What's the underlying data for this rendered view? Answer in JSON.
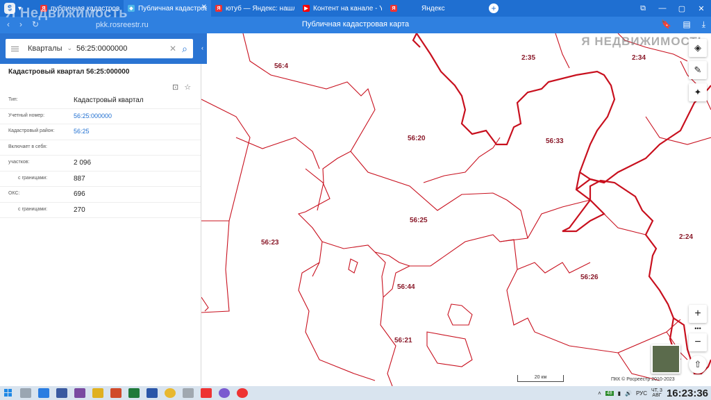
{
  "browser": {
    "tabs": [
      {
        "label": "публичная кадастровая к",
        "favicon": "yandex-icon",
        "active": false
      },
      {
        "label": "Публичная кадастрова",
        "favicon": "pkk-icon",
        "active": true
      },
      {
        "label": "ютуб — Яндекс: нашлось",
        "favicon": "yandex-icon",
        "active": false
      },
      {
        "label": "Контент на канале - YouTu",
        "favicon": "youtube-icon",
        "active": false
      },
      {
        "label": "Яндекс",
        "favicon": "yandex-icon",
        "active": false
      }
    ],
    "url": "pkk.rosreestr.ru",
    "page_title": "Публичная кадастровая карта"
  },
  "watermark": {
    "left": "Я Недвижимость",
    "right": "Я НЕДВИЖИМОСТЬ"
  },
  "search": {
    "type_selected": "Кварталы",
    "query": "56:25:0000000"
  },
  "info": {
    "title": "Кадастровый квартал 56:25:000000",
    "rows": [
      {
        "key": "Тип:",
        "value": "Кадастровый квартал",
        "link": false,
        "sub": false
      },
      {
        "key": "Учетный номер:",
        "value": "56:25:000000",
        "link": true,
        "sub": false
      },
      {
        "key": "Кадастровый район:",
        "value": "56:25",
        "link": true,
        "sub": false
      },
      {
        "key": "Включает в себя:",
        "value": "",
        "link": false,
        "sub": false
      },
      {
        "key": "участков:",
        "value": "2 096",
        "link": false,
        "sub": false
      },
      {
        "key": "с границами:",
        "value": "887",
        "link": false,
        "sub": true
      },
      {
        "key": "ОКС:",
        "value": "696",
        "link": false,
        "sub": false
      },
      {
        "key": "с границами:",
        "value": "270",
        "link": false,
        "sub": true
      }
    ]
  },
  "map": {
    "labels": [
      "56:4",
      "2:35",
      "2:34",
      "56:20",
      "56:33",
      "56:25",
      "56:23",
      "2:24",
      "56:44",
      "56:26",
      "56:21"
    ],
    "scale": "20 км",
    "copyright": "ПКК © Росреестр 2010-2023",
    "colors": {
      "border_thin": "#c8101e",
      "border_thick": "#c8101e",
      "label": "#8a1a2a"
    }
  },
  "taskbar": {
    "badge": "48",
    "lang": "РУС",
    "date_line1": "ЧТ, 3",
    "date_line2": "АВГ",
    "clock": "16:23:36"
  }
}
